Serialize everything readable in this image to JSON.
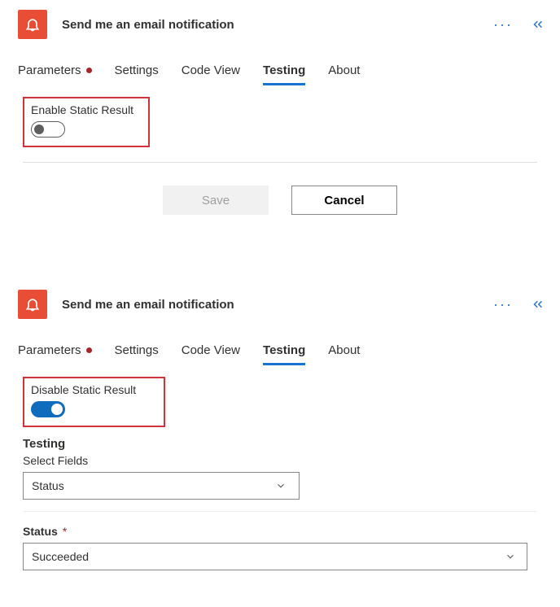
{
  "panel1": {
    "title": "Send me an email notification",
    "tabs": [
      {
        "label": "Parameters",
        "dirty": true
      },
      {
        "label": "Settings"
      },
      {
        "label": "Code View"
      },
      {
        "label": "Testing",
        "active": true
      },
      {
        "label": "About"
      }
    ],
    "toggle_label": "Enable Static Result",
    "toggle_on": false,
    "save_label": "Save",
    "cancel_label": "Cancel"
  },
  "panel2": {
    "title": "Send me an email notification",
    "tabs": [
      {
        "label": "Parameters",
        "dirty": true
      },
      {
        "label": "Settings"
      },
      {
        "label": "Code View"
      },
      {
        "label": "Testing",
        "active": true
      },
      {
        "label": "About"
      }
    ],
    "toggle_label": "Disable Static Result",
    "toggle_on": true,
    "section_heading": "Testing",
    "select_fields_label": "Select Fields",
    "select_fields_value": "Status",
    "status_label": "Status",
    "status_required": "*",
    "status_value": "Succeeded"
  }
}
